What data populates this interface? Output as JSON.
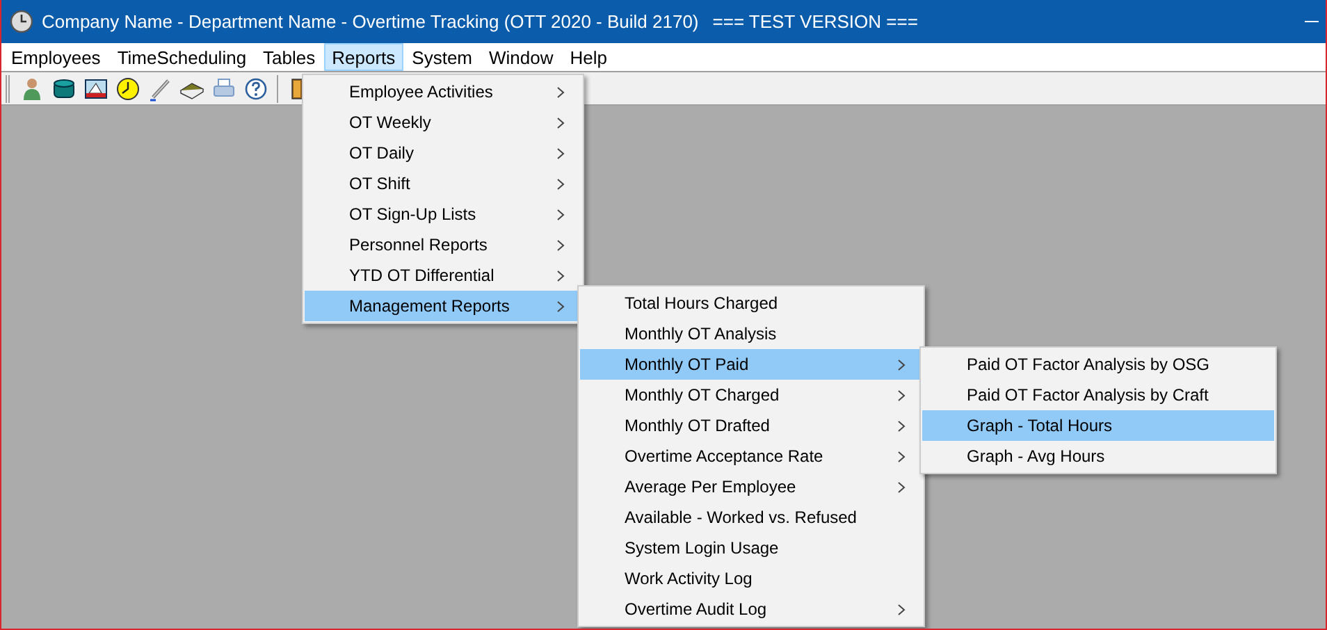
{
  "window": {
    "title": "Company Name - Department Name - Overtime Tracking (OTT 2020 - Build 2170)",
    "badge": "=== TEST VERSION ==="
  },
  "menu_bar": [
    {
      "label": "Employees",
      "selected": false
    },
    {
      "label": "TimeScheduling",
      "selected": false
    },
    {
      "label": "Tables",
      "selected": false
    },
    {
      "label": "Reports",
      "selected": true
    },
    {
      "label": "System",
      "selected": false
    },
    {
      "label": "Window",
      "selected": false
    },
    {
      "label": "Help",
      "selected": false
    }
  ],
  "menus": [
    {
      "items": [
        {
          "label": "Employee Activities",
          "submenu": true,
          "selected": false
        },
        {
          "label": "OT Weekly",
          "submenu": true,
          "selected": false
        },
        {
          "label": "OT Daily",
          "submenu": true,
          "selected": false
        },
        {
          "label": "OT Shift",
          "submenu": true,
          "selected": false
        },
        {
          "label": "OT Sign-Up Lists",
          "submenu": true,
          "selected": false
        },
        {
          "label": "Personnel Reports",
          "submenu": true,
          "selected": false
        },
        {
          "label": "YTD OT Differential",
          "submenu": true,
          "selected": false
        },
        {
          "label": "Management Reports",
          "submenu": true,
          "selected": true
        }
      ]
    },
    {
      "items": [
        {
          "label": "Total Hours Charged",
          "submenu": false,
          "selected": false
        },
        {
          "label": "Monthly OT Analysis",
          "submenu": false,
          "selected": false
        },
        {
          "label": "Monthly OT Paid",
          "submenu": true,
          "selected": true
        },
        {
          "label": "Monthly OT Charged",
          "submenu": true,
          "selected": false
        },
        {
          "label": "Monthly OT Drafted",
          "submenu": true,
          "selected": false
        },
        {
          "label": "Overtime Acceptance Rate",
          "submenu": true,
          "selected": false
        },
        {
          "label": "Average Per Employee",
          "submenu": true,
          "selected": false
        },
        {
          "label": "Available - Worked vs. Refused",
          "submenu": false,
          "selected": false
        },
        {
          "label": "System Login Usage",
          "submenu": false,
          "selected": false
        },
        {
          "label": "Work Activity Log",
          "submenu": false,
          "selected": false
        },
        {
          "label": "Overtime Audit Log",
          "submenu": true,
          "selected": false
        }
      ]
    },
    {
      "items": [
        {
          "label": "Paid OT Factor Analysis by OSG",
          "submenu": false,
          "selected": false
        },
        {
          "label": "Paid OT Factor Analysis by Craft",
          "submenu": false,
          "selected": false
        },
        {
          "label": "Graph - Total Hours",
          "submenu": false,
          "selected": true
        },
        {
          "label": "Graph - Avg Hours",
          "submenu": false,
          "selected": false
        }
      ]
    }
  ]
}
